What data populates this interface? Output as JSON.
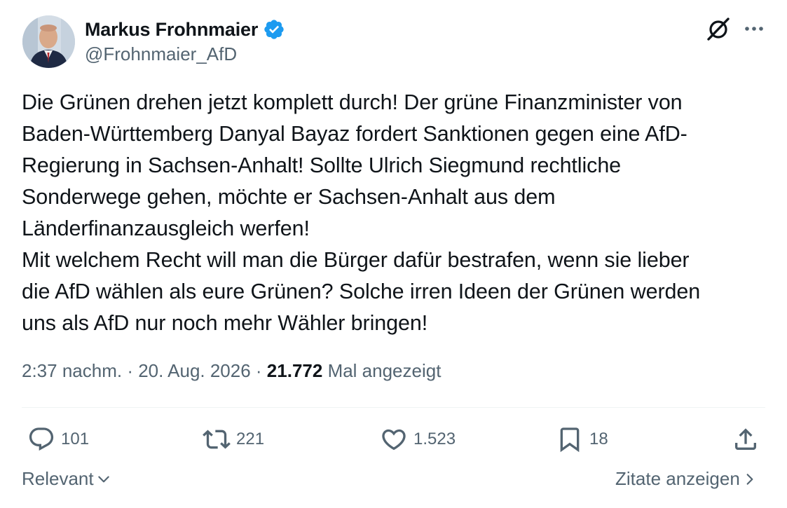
{
  "author": {
    "display_name": "Markus Frohnmaier",
    "handle": "@Frohnmaier_AfD",
    "verified": true,
    "avatar": "avatar-photo"
  },
  "header_icons": [
    "grok-icon",
    "more-icon"
  ],
  "tweet": {
    "text": "Die Grünen drehen jetzt komplett durch! Der grüne Finanzminister von\nBaden-Württemberg Danyal Bayaz fordert Sanktionen gegen eine AfD-\nRegierung in Sachsen-Anhalt! Sollte Ulrich Siegmund rechtliche\nSonderwege gehen, möchte er Sachsen-Anhalt aus dem\nLänderfinanzausgleich werfen!\nMit welchem Recht will man die Bürger dafür bestrafen, wenn sie lieber\ndie AfD wählen als eure Grünen? Solche irren Ideen der Grünen werden\nuns als AfD nur noch mehr Wähler bringen!",
    "time": "2:37 nachm.",
    "separator": " · ",
    "date": "20. Aug. 2026",
    "views": "21.772",
    "views_label": "Mal angezeigt"
  },
  "actions": {
    "reply": {
      "icon": "reply-icon",
      "count": "101"
    },
    "retweet": {
      "icon": "retweet-icon",
      "count": "221"
    },
    "like": {
      "icon": "heart-icon",
      "count": "1.523"
    },
    "bookmark": {
      "icon": "bookmark-icon",
      "count": "18"
    },
    "share": {
      "icon": "share-icon"
    }
  },
  "footer": {
    "sort_label": "Relevant",
    "quotes_label": "Zitate anzeigen"
  },
  "colors": {
    "text": "#0f1419",
    "secondary": "#536471",
    "verified": "#1d9bf0",
    "divider": "#eff3f4"
  }
}
